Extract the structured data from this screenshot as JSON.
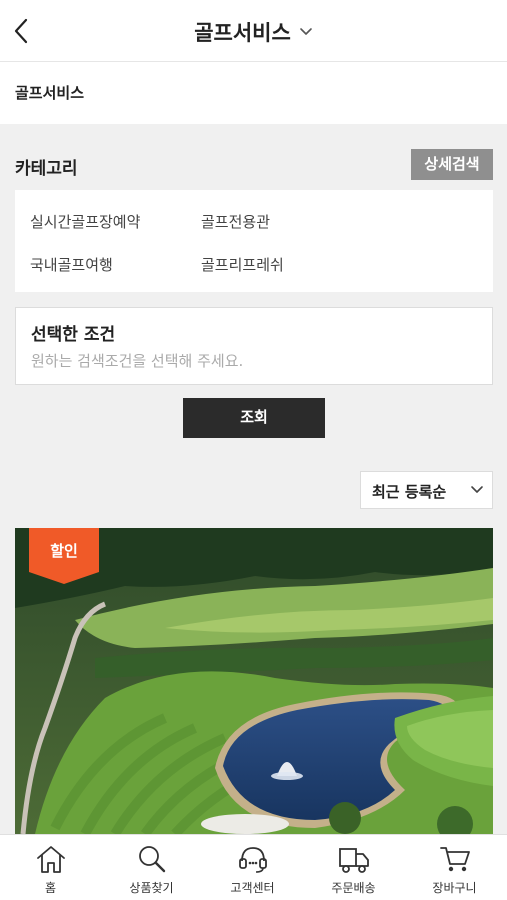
{
  "header": {
    "title": "골프서비스",
    "back_icon": "chevron-left-icon",
    "dropdown_icon": "chevron-down-icon"
  },
  "breadcrumb": {
    "label": "골프서비스"
  },
  "category": {
    "title": "카테고리",
    "detail_search_label": "상세검색",
    "items": [
      "실시간골프장예약",
      "골프전용관",
      "국내골프여행",
      "골프리프레쉬"
    ]
  },
  "condition": {
    "title": "선택한 조건",
    "hint": "원하는 검색조건을 선택해 주세요."
  },
  "search_button": {
    "label": "조회"
  },
  "sort": {
    "selected": "최근 등록순"
  },
  "product": {
    "badge": "할인",
    "badge_color": "#f05a28"
  },
  "tabbar": {
    "items": [
      {
        "label": "홈",
        "icon": "home-icon"
      },
      {
        "label": "상품찾기",
        "icon": "search-icon"
      },
      {
        "label": "고객센터",
        "icon": "headset-icon"
      },
      {
        "label": "주문배송",
        "icon": "delivery-truck-icon"
      },
      {
        "label": "장바구니",
        "icon": "cart-icon"
      }
    ]
  }
}
